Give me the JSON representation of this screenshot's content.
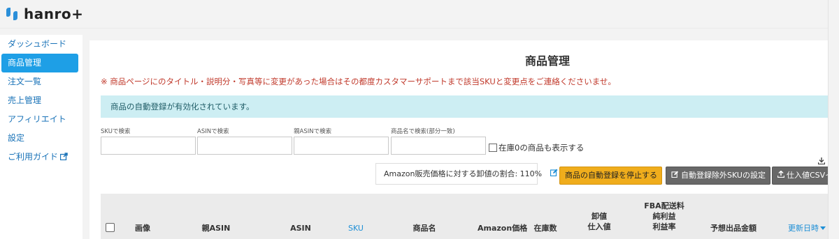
{
  "app": {
    "logo_text": "hanro+"
  },
  "sidebar": {
    "items": [
      {
        "label": "ダッシュボード"
      },
      {
        "label": "商品管理"
      },
      {
        "label": "注文一覧"
      },
      {
        "label": "売上管理"
      },
      {
        "label": "アフィリエイト"
      },
      {
        "label": "設定"
      },
      {
        "label": "ご利用ガイド"
      }
    ],
    "active_index": 1
  },
  "page": {
    "title": "商品管理",
    "notice": "※ 商品ページにのタイトル・説明分・写真等に変更があった場合はその都度カスタマーサポートまで該当SKUと変更点をご連絡くださいませ。",
    "info": "商品の自動登録が有効化されています。"
  },
  "filters": {
    "sku_label": "SKUで検索",
    "asin_label": "ASINで検索",
    "parent_asin_label": "親ASINで検索",
    "name_label": "商品名で検索(部分一致)",
    "sku_value": "",
    "asin_value": "",
    "parent_asin_value": "",
    "name_value": "",
    "show_zero_stock_label": "在庫0の商品も表示する",
    "show_zero_stock_checked": false
  },
  "toolbar": {
    "ratio_text": "Amazon販売価格に対する卸値の割合: 110%",
    "stop_auto_register_label": "商品の自動登録を停止する",
    "exclude_sku_label": "自動登録除外SKUの設定",
    "import_csv_label": "仕入値CSVイ"
  },
  "table": {
    "headers": {
      "image": "画像",
      "parent_asin": "親ASIN",
      "asin": "ASIN",
      "sku": "SKU",
      "product_name": "商品名",
      "amazon_price": "Amazon価格",
      "stock": "在庫数",
      "wholesale_1": "卸値",
      "wholesale_2": "仕入値",
      "fba_1": "FBA配送料",
      "fba_2": "純利益",
      "fba_3": "利益率",
      "expected_sales": "予想出品金額",
      "updated_at": "更新日時"
    },
    "sort_column": "updated_at",
    "sort_direction": "desc"
  },
  "colors": {
    "accent": "#1e9fe6",
    "link": "#1e8fd6",
    "warning_button": "#f0ad1c",
    "info_bar": "#cdeef3",
    "notice_text": "#c0392b",
    "logo_blue": "#2b8fd9"
  }
}
